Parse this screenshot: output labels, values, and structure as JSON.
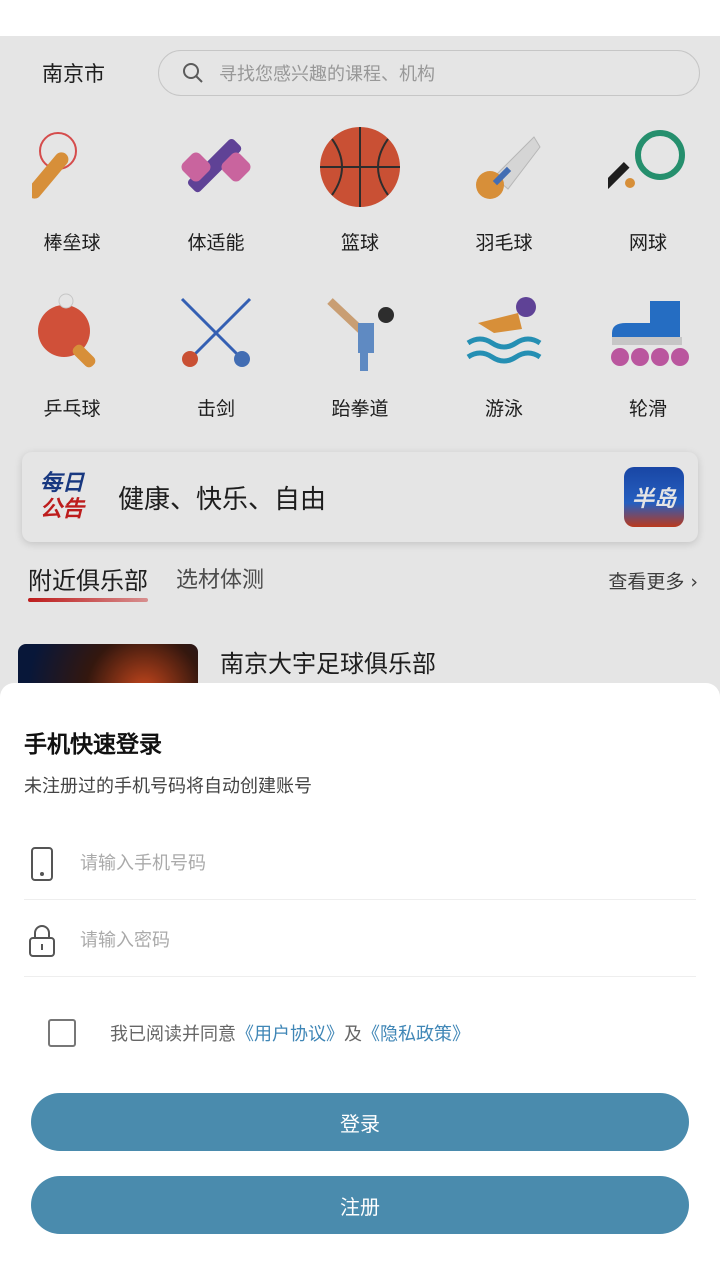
{
  "header": {
    "city": "南京市",
    "search_placeholder": "寻找您感兴趣的课程、机构"
  },
  "categories": [
    {
      "label": "棒垒球",
      "icon": "baseball-icon"
    },
    {
      "label": "体适能",
      "icon": "dumbbell-icon"
    },
    {
      "label": "篮球",
      "icon": "basketball-icon"
    },
    {
      "label": "羽毛球",
      "icon": "shuttlecock-icon"
    },
    {
      "label": "网球",
      "icon": "tennis-racket-icon"
    },
    {
      "label": "乒乓球",
      "icon": "ping-pong-icon"
    },
    {
      "label": "击剑",
      "icon": "fencing-icon"
    },
    {
      "label": "跆拳道",
      "icon": "taekwondo-icon"
    },
    {
      "label": "游泳",
      "icon": "swimming-icon"
    },
    {
      "label": "轮滑",
      "icon": "roller-skate-icon"
    }
  ],
  "notice": {
    "logo_line1": "每日",
    "logo_line2": "公告",
    "text": "健康、快乐、自由",
    "app_logo": "半岛"
  },
  "tabs": {
    "nearby": "附近俱乐部",
    "test": "选材体测",
    "more": "查看更多"
  },
  "club": {
    "name": "南京大宇足球俱乐部"
  },
  "login": {
    "title": "手机快速登录",
    "subtitle": "未注册过的手机号码将自动创建账号",
    "phone_placeholder": "请输入手机号码",
    "password_placeholder": "请输入密码",
    "agree_prefix": "我已阅读并同意",
    "user_agreement": "《用户协议》",
    "and": "及",
    "privacy_policy": "《隐私政策》",
    "login_button": "登录",
    "register_button": "注册",
    "accent": "#4a8bad"
  }
}
